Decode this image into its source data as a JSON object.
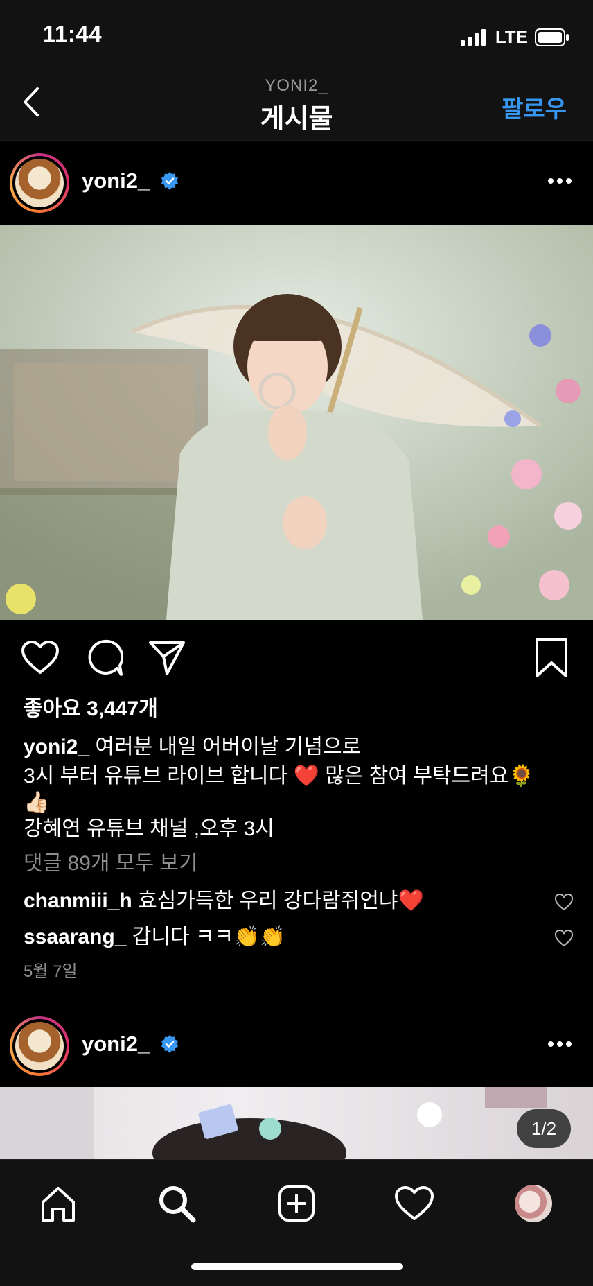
{
  "status_bar": {
    "time": "11:44",
    "network": "LTE"
  },
  "nav": {
    "account": "YONI2_",
    "title": "게시물",
    "follow": "팔로우"
  },
  "post": {
    "username": "yoni2_",
    "likes": "좋아요 3,447개",
    "caption_user": "yoni2_",
    "caption_line1": "여러분 내일 어버이날 기념으로",
    "caption_line2": "3시 부터 유튜브 라이브 합니다 ❤️ 많은 참여 부탁드려요🌻",
    "caption_line3": "👍🏻",
    "caption_line4": "강혜연 유튜브 채널 ,오후 3시",
    "view_comments": "댓글 89개 모두 보기",
    "comments": [
      {
        "user": "chanmiii_h",
        "text": "효심가득한 우리 강다람쥐언냐❤️"
      },
      {
        "user": "ssaarang_",
        "text": "갑니다 ㅋㅋ👏👏"
      }
    ],
    "date": "5월 7일"
  },
  "next_post": {
    "username": "yoni2_",
    "pager": "1/2"
  },
  "icons": {
    "back": "chevron-left-icon",
    "verified": "verified-badge-icon",
    "more": "more-horizontal-icon",
    "like": "heart-icon",
    "comment": "comment-icon",
    "share": "paper-plane-icon",
    "save": "bookmark-icon",
    "home": "home-icon",
    "search": "search-icon",
    "create": "plus-square-icon",
    "activity": "heart-icon",
    "profile": "avatar"
  },
  "colors": {
    "accent": "#3797f0",
    "background": "#000000",
    "verified": "#3897f0"
  }
}
